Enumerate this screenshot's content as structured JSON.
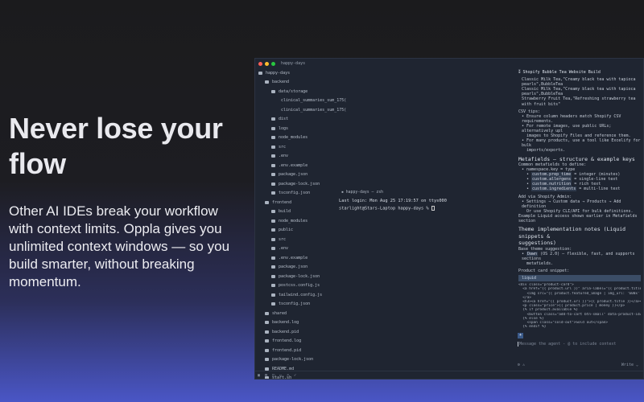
{
  "hero": {
    "title": "Never lose your flow",
    "body": "Other AI IDEs break your workflow with context limits.  Oppla gives you unlimited context windows — so you build smarter, without breaking momentum."
  },
  "window": {
    "title": "happy-days"
  },
  "tree": [
    {
      "label": "happy-days",
      "depth": 0
    },
    {
      "label": "backend",
      "depth": 1
    },
    {
      "label": "data/storage",
      "depth": 2
    },
    {
      "label": "clinical_summaries_sum_175(",
      "depth": 3
    },
    {
      "label": "clinical_summaries_sum_175(",
      "depth": 3
    },
    {
      "label": "dist",
      "depth": 2
    },
    {
      "label": "logs",
      "depth": 2
    },
    {
      "label": "node_modules",
      "depth": 2
    },
    {
      "label": "src",
      "depth": 2
    },
    {
      "label": ".env",
      "depth": 2
    },
    {
      "label": ".env.example",
      "depth": 2
    },
    {
      "label": "package.json",
      "depth": 2
    },
    {
      "label": "package-lock.json",
      "depth": 2
    },
    {
      "label": "tsconfig.json",
      "depth": 2
    },
    {
      "label": "frontend",
      "depth": 1
    },
    {
      "label": "build",
      "depth": 2
    },
    {
      "label": "node_modules",
      "depth": 2
    },
    {
      "label": "public",
      "depth": 2
    },
    {
      "label": "src",
      "depth": 2
    },
    {
      "label": ".env",
      "depth": 2
    },
    {
      "label": ".env.example",
      "depth": 2
    },
    {
      "label": "package.json",
      "depth": 2
    },
    {
      "label": "package-lock.json",
      "depth": 2
    },
    {
      "label": "postcss.config.js",
      "depth": 2
    },
    {
      "label": "tailwind.config.js",
      "depth": 2
    },
    {
      "label": "tsconfig.json",
      "depth": 2
    },
    {
      "label": "shared",
      "depth": 1
    },
    {
      "label": "backend.log",
      "depth": 1
    },
    {
      "label": "backend.pid",
      "depth": 1
    },
    {
      "label": "frontend.log",
      "depth": 1
    },
    {
      "label": "frontend.pid",
      "depth": 1
    },
    {
      "label": "package-lock.json",
      "depth": 1
    },
    {
      "label": "README.md",
      "depth": 1
    },
    {
      "label": "start.sh",
      "depth": 1
    }
  ],
  "terminal": {
    "tab": "happy-days — zsh",
    "lines": [
      "Last login: Mon Aug 25 17:19:57 on ttys000",
      "starlight@Stars-Laptop happy-days % "
    ]
  },
  "chat": {
    "title": "Shopify Bubble Tea Website Build",
    "csv_rows": [
      "Classic Milk Tea,\"Creamy black tea with tapioca pearls\",BubbleTea",
      "Classic Milk Tea,\"Creamy black tea with tapioca pearls\",BubbleTea",
      "Strawberry Fruit Tea,\"Refreshing strawberry tea with fruit bits\""
    ],
    "csv_tips_heading": "CSV tips:",
    "csv_tips": [
      "• Ensure column headers match Shopify CSV requirements.",
      "• For remote images, use public URLs; alternatively upl",
      "  images to Shopify Files and reference them.",
      "• For many products, use a tool like Excelify for bulk",
      "  imports/exports."
    ],
    "metafields_heading": "Metafields — structure & example keys",
    "metafields_intro": "Common metafields to define:",
    "namespace": "• namespace.key = type",
    "keys": [
      {
        "key": "custom.prep_time",
        "type": "= integer (minutes)"
      },
      {
        "key": "custom.allergens",
        "type": "= single-line text"
      },
      {
        "key": "custom.nutrition",
        "type": "= rich text"
      },
      {
        "key": "custom.ingredients",
        "type": "= multi-line text"
      }
    ],
    "add_via": "Add via Shopify Admin:",
    "add_lines": [
      "• Settings → Custom data → Products → Add definition",
      "  Or use Shopify CLI/API for bulk definitions."
    ],
    "example": "Example Liquid access shown earlier in Metafields section",
    "theme_heading_1": "Theme implementation notes (Liquid snippets &",
    "theme_heading_2": "suggestions)",
    "base_theme": "Base theme suggestion:",
    "dawn": "Dawn",
    "dawn_rest": "(OS 2.0) — flexible, fast, and supports sections",
    "dawn_rest2": "metafields.",
    "card_snippet": "Product card snippet:",
    "lang": "liquid",
    "code": [
      "<div class=\"product-card\">",
      "  <a href=\"{{ product.url }}\" aria-label=\"{{ product.title }}\">",
      "    <img src=\"{{ product.featured_image | img_url: '600x' }}\" al",
      "  </a>",
      "  <h3><a href=\"{{ product.url }}\">{{ product.title }}</a></h3>",
      "  <p class=\"price\">{{ product.price | money }}</p>",
      "  {% if product.available %}",
      "    <button class=\"add-to-cart btn-small\" data-product-id=\"{{ pr",
      "  {% else %}",
      "    <span class=\"sold-out\">Sold out</span>",
      "  {% endif %}"
    ],
    "input_placeholder": "Message the agent - @ to include context",
    "mode": "Write ⌄"
  }
}
